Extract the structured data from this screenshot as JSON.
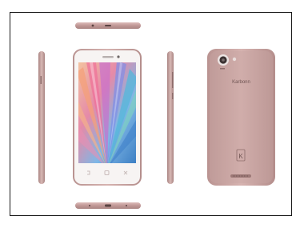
{
  "product": {
    "brand_label": "Karbonn",
    "back_emblem": "K",
    "colors": {
      "body": "#c8a4a2",
      "body_dark": "#a98482",
      "body_light": "#dcbcb9",
      "bezel": "#f7f4f3",
      "border": "#1a1a1a"
    },
    "views": [
      "top-edge",
      "left-side",
      "front",
      "right-side",
      "back",
      "bottom-edge"
    ]
  }
}
